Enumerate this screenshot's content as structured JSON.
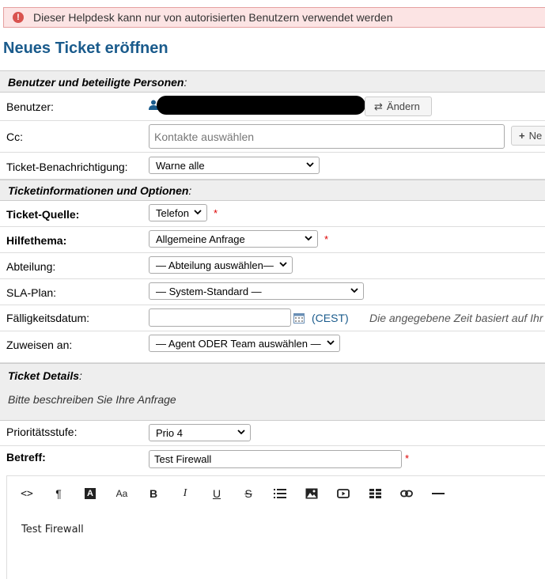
{
  "alert": {
    "text": "Dieser Helpdesk kann nur von autorisierten Benutzern verwendet werden"
  },
  "page_title": "Neues Ticket eröffnen",
  "section_users": {
    "title": "Benutzer und beteiligte Personen",
    "suffix": ":"
  },
  "user": {
    "label": "Benutzer:",
    "change_button": "Ändern"
  },
  "cc": {
    "label": "Cc:",
    "placeholder": "Kontakte auswählen",
    "new_button": "Ne"
  },
  "notify": {
    "label": "Ticket-Benachrichtigung:",
    "value": "Warne alle"
  },
  "section_info": {
    "title": "Ticketinformationen und Optionen",
    "suffix": ":"
  },
  "source": {
    "label": "Ticket-Quelle:",
    "value": "Telefon"
  },
  "topic": {
    "label": "Hilfethema:",
    "value": "Allgemeine Anfrage"
  },
  "department": {
    "label": "Abteilung:",
    "value": "— Abteilung auswählen—"
  },
  "sla": {
    "label": "SLA-Plan:",
    "value": "— System-Standard —"
  },
  "due": {
    "label": "Fälligkeitsdatum:",
    "tz": "(CEST)",
    "note": "Die angegebene Zeit basiert auf Ihr"
  },
  "assign": {
    "label": "Zuweisen an:",
    "value": "— Agent ODER Team auswählen —"
  },
  "section_details": {
    "title": "Ticket Details",
    "suffix": ":",
    "desc": "Bitte beschreiben Sie Ihre Anfrage"
  },
  "priority": {
    "label": "Prioritätsstufe:",
    "value": "Prio 4"
  },
  "subject": {
    "label": "Betreff:",
    "value": "Test Firewall"
  },
  "required_mark": "*",
  "toolbar": {
    "code": "<>",
    "paragraph": "¶",
    "font_size": "Aa",
    "bold": "B",
    "italic": "I",
    "underline": "U",
    "strike": "S"
  },
  "editor": {
    "body": "Test Firewall"
  }
}
